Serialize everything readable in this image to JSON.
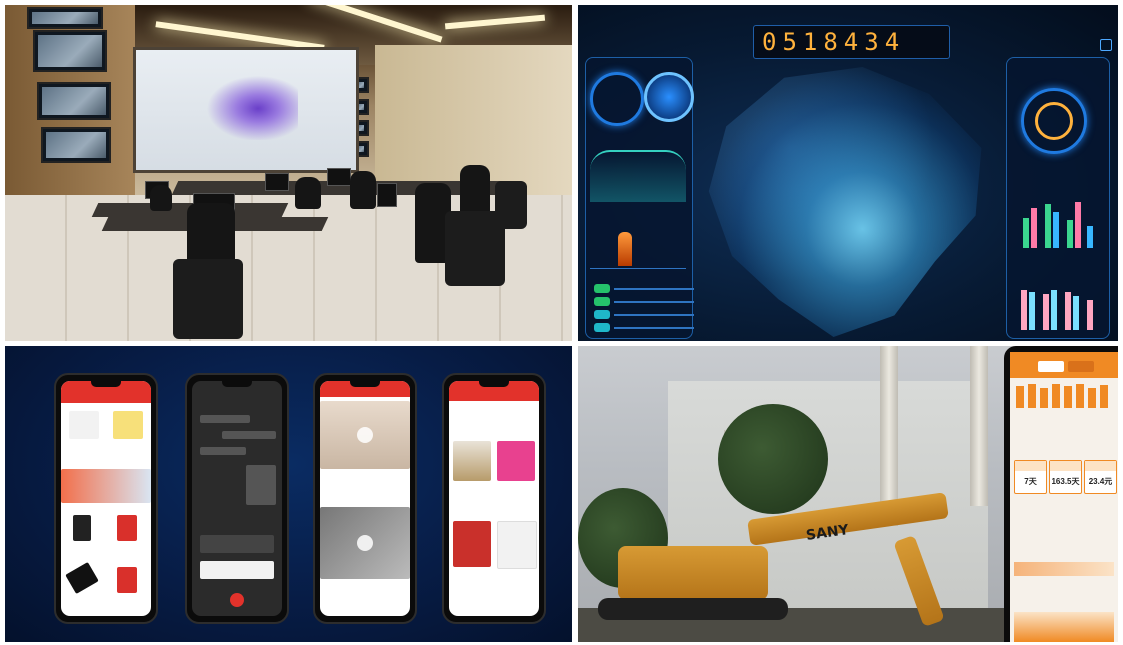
{
  "dashboard": {
    "counter_digits": "0518434",
    "accent_color": "#ffb23d",
    "map_color": "#4fd0ff"
  },
  "app": {
    "stats": [
      {
        "label": "",
        "value": "7天"
      },
      {
        "label": "",
        "value": "163.5天"
      },
      {
        "label": "",
        "value": "23.4元"
      }
    ],
    "brand": "SANY"
  }
}
